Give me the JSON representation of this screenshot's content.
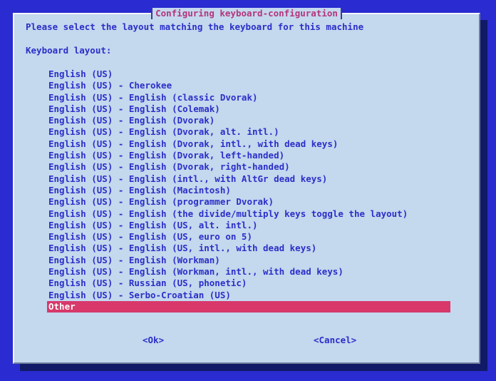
{
  "dialog": {
    "title": "Configuring keyboard-configuration",
    "prompt": "Please select the layout matching the keyboard for this machine",
    "section_label": "Keyboard layout:",
    "items": [
      "English (US)",
      "English (US) - Cherokee",
      "English (US) - English (classic Dvorak)",
      "English (US) - English (Colemak)",
      "English (US) - English (Dvorak)",
      "English (US) - English (Dvorak, alt. intl.)",
      "English (US) - English (Dvorak, intl., with dead keys)",
      "English (US) - English (Dvorak, left-handed)",
      "English (US) - English (Dvorak, right-handed)",
      "English (US) - English (intl., with AltGr dead keys)",
      "English (US) - English (Macintosh)",
      "English (US) - English (programmer Dvorak)",
      "English (US) - English (the divide/multiply keys toggle the layout)",
      "English (US) - English (US, alt. intl.)",
      "English (US) - English (US, euro on 5)",
      "English (US) - English (US, intl., with dead keys)",
      "English (US) - English (Workman)",
      "English (US) - English (Workman, intl., with dead keys)",
      "English (US) - Russian (US, phonetic)",
      "English (US) - Serbo-Croatian (US)",
      "Other"
    ],
    "selected_index": 20,
    "ok_label": "<Ok>",
    "cancel_label": "<Cancel>"
  },
  "colors": {
    "background": "#2a2bd0",
    "dialog": "#c4d8ee",
    "text": "#2b2fc8",
    "title": "#b4357a",
    "highlight": "#d8386a"
  }
}
